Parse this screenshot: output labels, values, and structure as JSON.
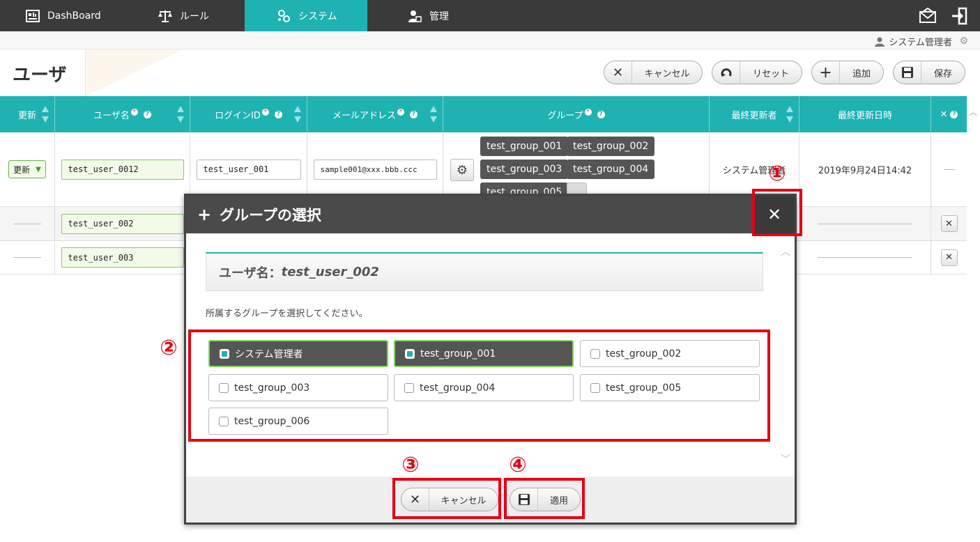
{
  "nav": {
    "items": [
      {
        "label": "DashBoard",
        "icon": "dashboard-icon"
      },
      {
        "label": "ルール",
        "icon": "scale-icon"
      },
      {
        "label": "システム",
        "icon": "gears-icon"
      },
      {
        "label": "管理",
        "icon": "user-admin-icon"
      }
    ],
    "active": "システム",
    "accent": "#1fb2b2"
  },
  "userbar": {
    "name": "システム管理者"
  },
  "page": {
    "title": "ユーザ",
    "toolbar": {
      "cancel": "キャンセル",
      "reset": "リセット",
      "add": "追加",
      "save": "保存"
    }
  },
  "table": {
    "headers": {
      "update": "更新",
      "username": "ユーザ名",
      "login_id": "ログインID",
      "email": "メールアドレス",
      "group": "グループ",
      "last_updater": "最終更新者",
      "last_updated": "最終更新日時",
      "delete": "✕"
    },
    "rows": [
      {
        "update": "更新",
        "username": "test_user_0012",
        "login_id": "test_user_001",
        "email": "sample001@xxx.bbb.ccc",
        "groups": [
          "test_group_001",
          "test_group_002",
          "test_group_003",
          "test_group_004",
          "test_group_005",
          "..."
        ],
        "last_updater": "システム管理者",
        "last_updated": "2019年9月24日14:42"
      },
      {
        "username": "test_user_002"
      },
      {
        "username": "test_user_003"
      }
    ]
  },
  "modal": {
    "title": "グループの選択",
    "user_label": "ユーザ名：",
    "user_value": "test_user_002",
    "instruction": "所属するグループを選択してください。",
    "options": [
      {
        "label": "システム管理者",
        "checked": true
      },
      {
        "label": "test_group_001",
        "checked": true
      },
      {
        "label": "test_group_002",
        "checked": false
      },
      {
        "label": "test_group_003",
        "checked": false
      },
      {
        "label": "test_group_004",
        "checked": false
      },
      {
        "label": "test_group_005",
        "checked": false
      },
      {
        "label": "test_group_006",
        "checked": false
      }
    ],
    "cancel": "キャンセル",
    "apply": "適用"
  },
  "annotations": {
    "n1": "①",
    "n2": "②",
    "n3": "③",
    "n4": "④",
    "color": "#e60012"
  }
}
